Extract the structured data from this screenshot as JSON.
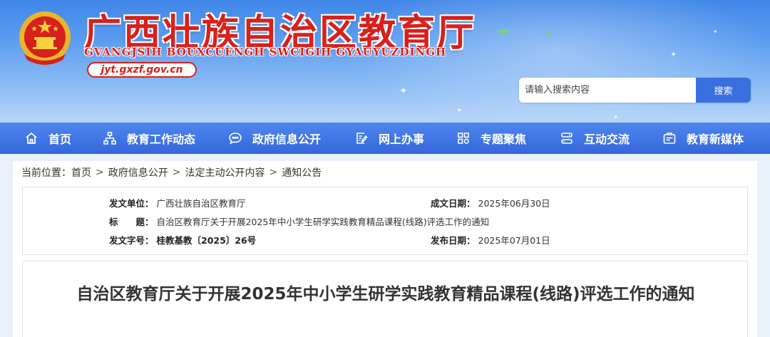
{
  "header": {
    "title": "广西壮族自治区教育厅",
    "subtitle": "GVANGJSIH BOUXCUENGH SWCIGIH GYAUYUZDINGH",
    "domain": "jyt.gxzf.gov.cn"
  },
  "search": {
    "placeholder": "请输入搜索内容",
    "button_label": "搜索"
  },
  "nav": {
    "items": [
      {
        "label": "首页",
        "icon": "home-icon"
      },
      {
        "label": "教育工作动态",
        "icon": "sitemap-icon"
      },
      {
        "label": "政府信息公开",
        "icon": "chat-icon"
      },
      {
        "label": "网上办事",
        "icon": "edit-doc-icon"
      },
      {
        "label": "专题聚焦",
        "icon": "grid-icon"
      },
      {
        "label": "互动交流",
        "icon": "exchange-icon"
      },
      {
        "label": "教育新媒体",
        "icon": "media-icon"
      }
    ]
  },
  "breadcrumb": {
    "prefix": "当前位置：",
    "items": [
      "首页",
      "政府信息公开",
      "法定主动公开内容",
      "通知公告"
    ],
    "separator": ">"
  },
  "meta": {
    "issuer_label": "发文单位：",
    "issuer": "广西壮族自治区教育厅",
    "date_label": "成文日期：",
    "date": "2025年06月30日",
    "title_label": "标　　题：",
    "title": "自治区教育厅关于开展2025年中小学生研学实践教育精品课程(线路)评选工作的通知",
    "docno_label": "发文字号：",
    "docno": "桂教基教〔2025〕26号",
    "publish_label": "发布日期：",
    "publish": "2025年07月01日"
  },
  "article": {
    "title": "自治区教育厅关于开展2025年中小学生研学实践教育精品课程(线路)评选工作的通知"
  },
  "colors": {
    "title_red": "#d8201c",
    "nav_blue": "#3467dc",
    "search_button": "#3a6fe0"
  }
}
